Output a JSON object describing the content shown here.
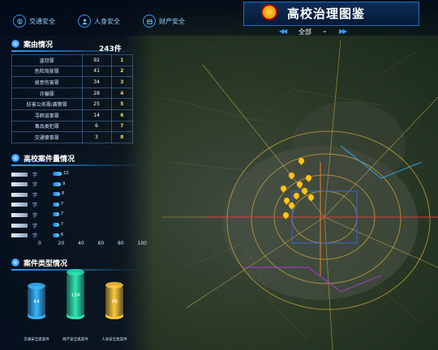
{
  "app": {
    "title": "高校治理图鉴"
  },
  "tabs": [
    {
      "label": "交通安全",
      "icon": "traffic-icon"
    },
    {
      "label": "人身安全",
      "icon": "person-icon"
    },
    {
      "label": "财产安全",
      "icon": "property-icon"
    }
  ],
  "scope": {
    "selected": "全部"
  },
  "case_info": {
    "title": "案由情况",
    "total": "243件",
    "rows": [
      {
        "name": "盗窃罪",
        "count": "92",
        "rank": "1"
      },
      {
        "name": "危险驾驶罪",
        "count": "41",
        "rank": "2"
      },
      {
        "name": "故意伤害罪",
        "count": "34",
        "rank": "3"
      },
      {
        "name": "诈骗罪",
        "count": "28",
        "rank": "4"
      },
      {
        "name": "妨害公务罪/袭警罪",
        "count": "25",
        "rank": "5"
      },
      {
        "name": "寻衅滋事罪",
        "count": "14",
        "rank": "6"
      },
      {
        "name": "毒品类犯罪",
        "count": "6",
        "rank": "7"
      },
      {
        "name": "交通肇事罪",
        "count": "3",
        "rank": "8"
      }
    ]
  },
  "university_cases": {
    "title": "高校案件量情况",
    "axis_ticks": [
      "0",
      "20",
      "40",
      "60",
      "80",
      "100"
    ],
    "bars": [
      {
        "prefix": "学",
        "value": 10
      },
      {
        "prefix": "学",
        "value": 9
      },
      {
        "prefix": "学",
        "value": 8
      },
      {
        "prefix": "学",
        "value": 7
      },
      {
        "prefix": "学",
        "value": 7
      },
      {
        "prefix": "学",
        "value": 7
      },
      {
        "prefix": "学",
        "value": 6
      }
    ]
  },
  "case_types": {
    "title": "案件类型情况",
    "items": [
      {
        "label": "交通安全类案件",
        "value": "44",
        "color": "#37b6ff"
      },
      {
        "label": "财产安全类案件",
        "value": "134",
        "color": "#2fe8b0"
      },
      {
        "label": "人身安全类案件",
        "value": "48",
        "color": "#ffc93a"
      }
    ]
  },
  "colors": {
    "accent": "#2e9bff",
    "pin": "#ffc515",
    "rank": "#ffd84d"
  }
}
